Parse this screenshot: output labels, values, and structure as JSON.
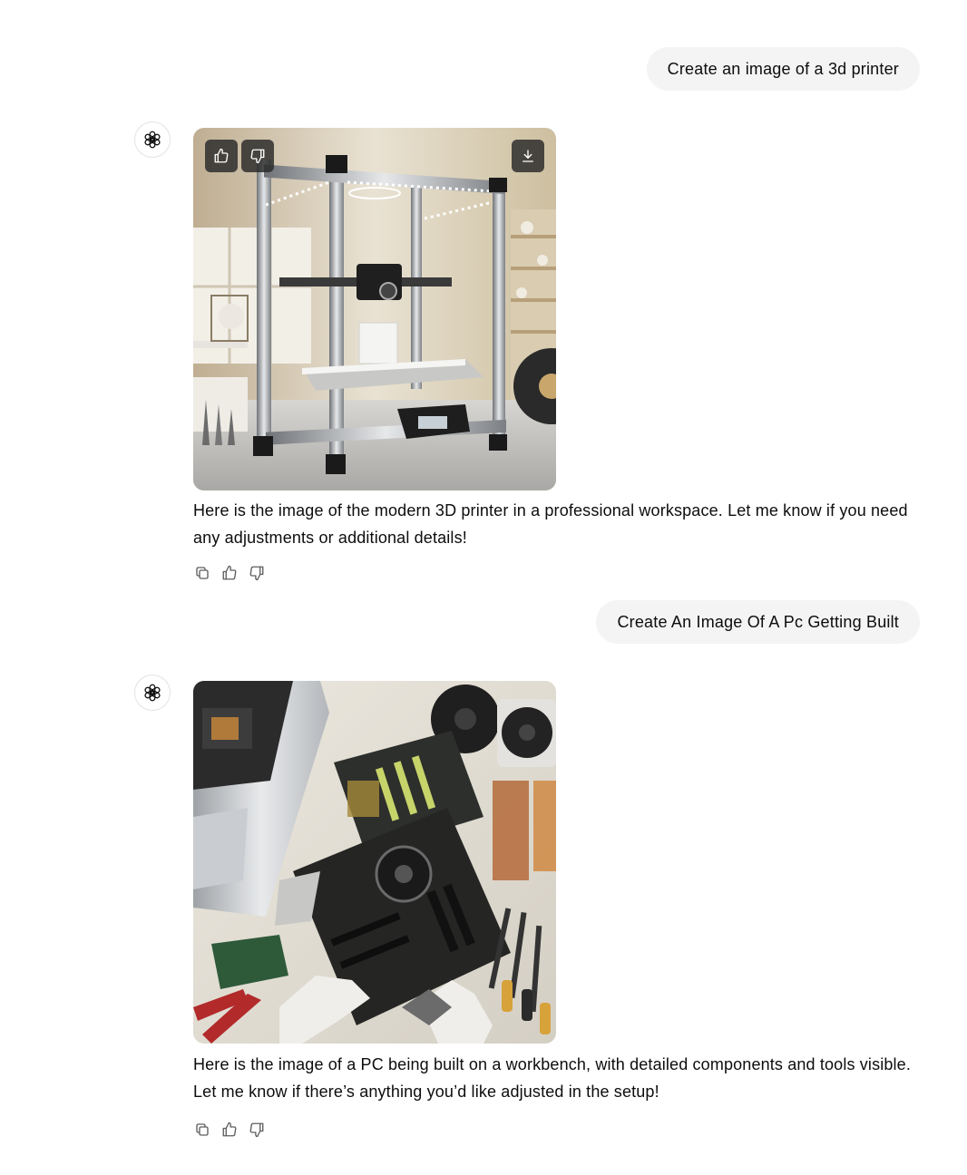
{
  "conversation": {
    "messages": [
      {
        "role": "user",
        "text": "Create an image of a 3d printer"
      },
      {
        "role": "assistant",
        "image_alt": "modern 3D printer in a professional workspace",
        "text": "Here is the image of the modern 3D printer in a professional workspace. Let me know if you need any adjustments or additional details!",
        "image_actions": [
          "thumbs-up-icon",
          "thumbs-down-icon",
          "download-icon"
        ],
        "actions": [
          "copy-icon",
          "thumbs-up-icon",
          "thumbs-down-icon"
        ]
      },
      {
        "role": "user",
        "text": "Create An Image Of A Pc Getting Built"
      },
      {
        "role": "assistant",
        "image_alt": "PC being built on a workbench with components and tools",
        "text": "Here is the image of a PC being built on a workbench, with detailed components and tools visible. Let me know if there’s anything you’d like adjusted in the setup!",
        "actions": [
          "copy-icon",
          "thumbs-up-icon",
          "thumbs-down-icon"
        ]
      }
    ]
  },
  "colors": {
    "user_bubble_bg": "#f4f4f4",
    "text": "#0d0d0d",
    "icon_gray": "#5d5d5d"
  }
}
